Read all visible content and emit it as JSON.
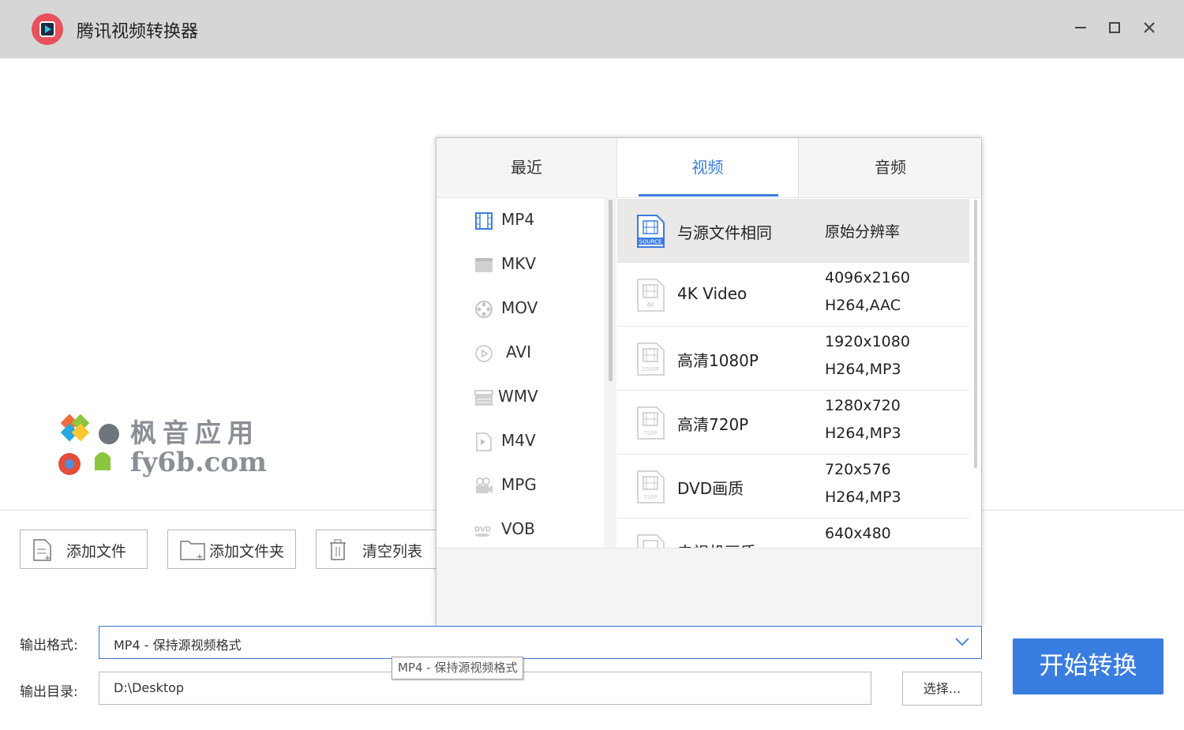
{
  "app": {
    "title": "腾讯视频转换器"
  },
  "window_controls": {
    "minimize": "—",
    "maximize": "☐",
    "close": "✕"
  },
  "watermark": {
    "line1": "枫音应用",
    "line2": "fy6b.com"
  },
  "toolbar": {
    "add_file": "添加文件",
    "add_folder": "添加文件夹",
    "clear_list": "清空列表"
  },
  "popup": {
    "tabs": [
      "最近",
      "视频",
      "音频"
    ],
    "active_tab": "视频",
    "formats": [
      {
        "name": "MP4",
        "icon": "film-icon"
      },
      {
        "name": "MKV",
        "icon": "clapper-icon"
      },
      {
        "name": "MOV",
        "icon": "reel-icon"
      },
      {
        "name": "AVI",
        "icon": "play-circle-icon"
      },
      {
        "name": "WMV",
        "icon": "clapper-stripe-icon"
      },
      {
        "name": "M4V",
        "icon": "file-m4v-icon"
      },
      {
        "name": "MPG",
        "icon": "camera-icon"
      },
      {
        "name": "VOB",
        "icon": "dvd-icon"
      }
    ],
    "presets": [
      {
        "name": "与源文件相同",
        "detail": "原始分辨率",
        "icon_label": "SOURCE"
      },
      {
        "name": "4K Video",
        "resolution": "4096x2160",
        "codec": "H264,AAC",
        "icon_label": "4K"
      },
      {
        "name": "高清1080P",
        "resolution": "1920x1080",
        "codec": "H264,MP3",
        "icon_label": "1080P"
      },
      {
        "name": "高清720P",
        "resolution": "1280x720",
        "codec": "H264,MP3",
        "icon_label": "720P"
      },
      {
        "name": "DVD画质",
        "resolution": "720x576",
        "codec": "H264,MP3",
        "icon_label": "720P"
      },
      {
        "name": "电视机画质",
        "resolution": "640x480",
        "codec": "",
        "icon_label": ""
      }
    ]
  },
  "output": {
    "format_label": "输出格式:",
    "format_value": "MP4 - 保持源视频格式",
    "tooltip": "MP4 - 保持源视频格式",
    "dir_label": "输出目录:",
    "dir_value": "D:\\Desktop",
    "choose_button": "选择...",
    "start_button": "开始转换"
  },
  "colors": {
    "accent": "#3a7de0",
    "titlebar": "#d6d6d6",
    "logo": "#e8505b"
  }
}
